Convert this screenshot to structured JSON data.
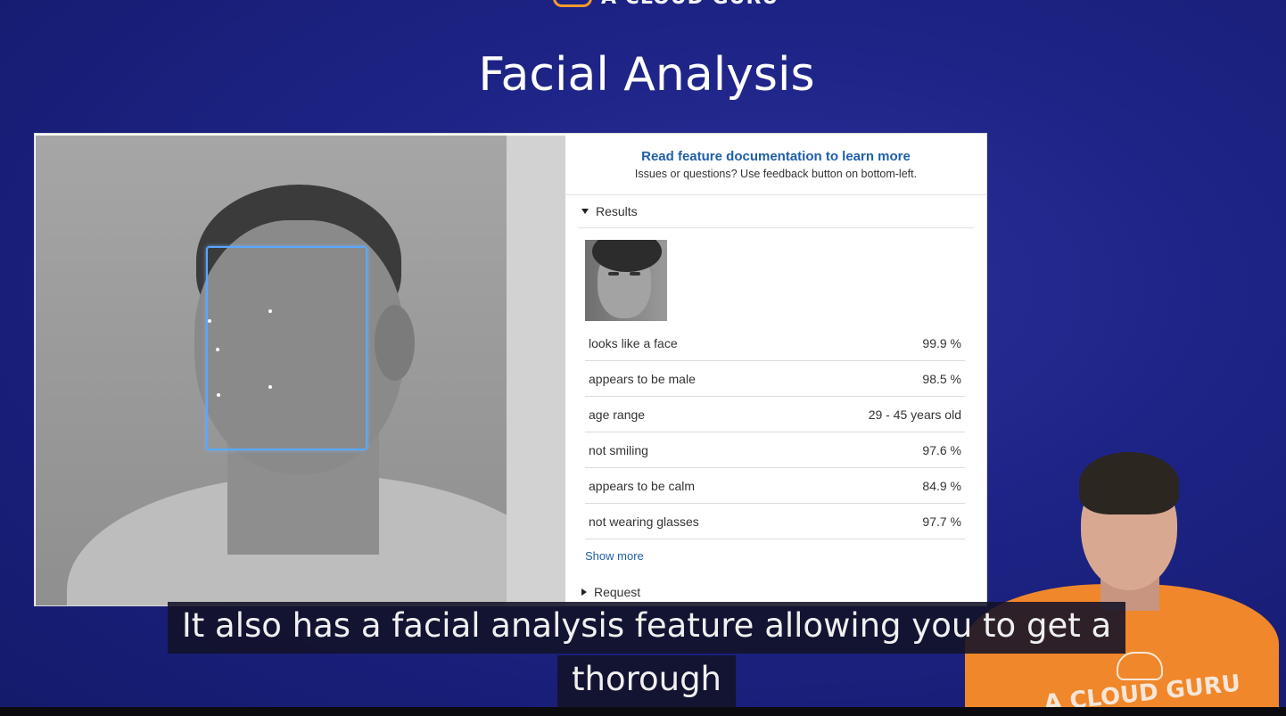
{
  "brand": {
    "name": "A CLOUD GURU"
  },
  "slide": {
    "title": "Facial Analysis"
  },
  "panel": {
    "doc_link": "Read feature documentation to learn more",
    "doc_subtitle": "Issues or questions? Use feedback button on bottom-left.",
    "results_label": "Results",
    "rows": [
      {
        "label": "looks like a face",
        "value": "99.9 %"
      },
      {
        "label": "appears to be male",
        "value": "98.5 %"
      },
      {
        "label": "age range",
        "value": "29 - 45 years old"
      },
      {
        "label": "not smiling",
        "value": "97.6 %"
      },
      {
        "label": "appears to be calm",
        "value": "84.9 %"
      },
      {
        "label": "not wearing glasses",
        "value": "97.7 %"
      }
    ],
    "show_more": "Show more",
    "request_label": "Request"
  },
  "speaker": {
    "shirt_text": "A CLOUD GURU"
  },
  "captions": {
    "line1": "It also has a facial analysis feature allowing you to get a",
    "line2": "thorough"
  },
  "colors": {
    "background": "#1d2384",
    "link": "#1f5fa8",
    "face_box": "#5aa7ff",
    "caption_bg": "#121228",
    "shirt": "#f0872a"
  }
}
